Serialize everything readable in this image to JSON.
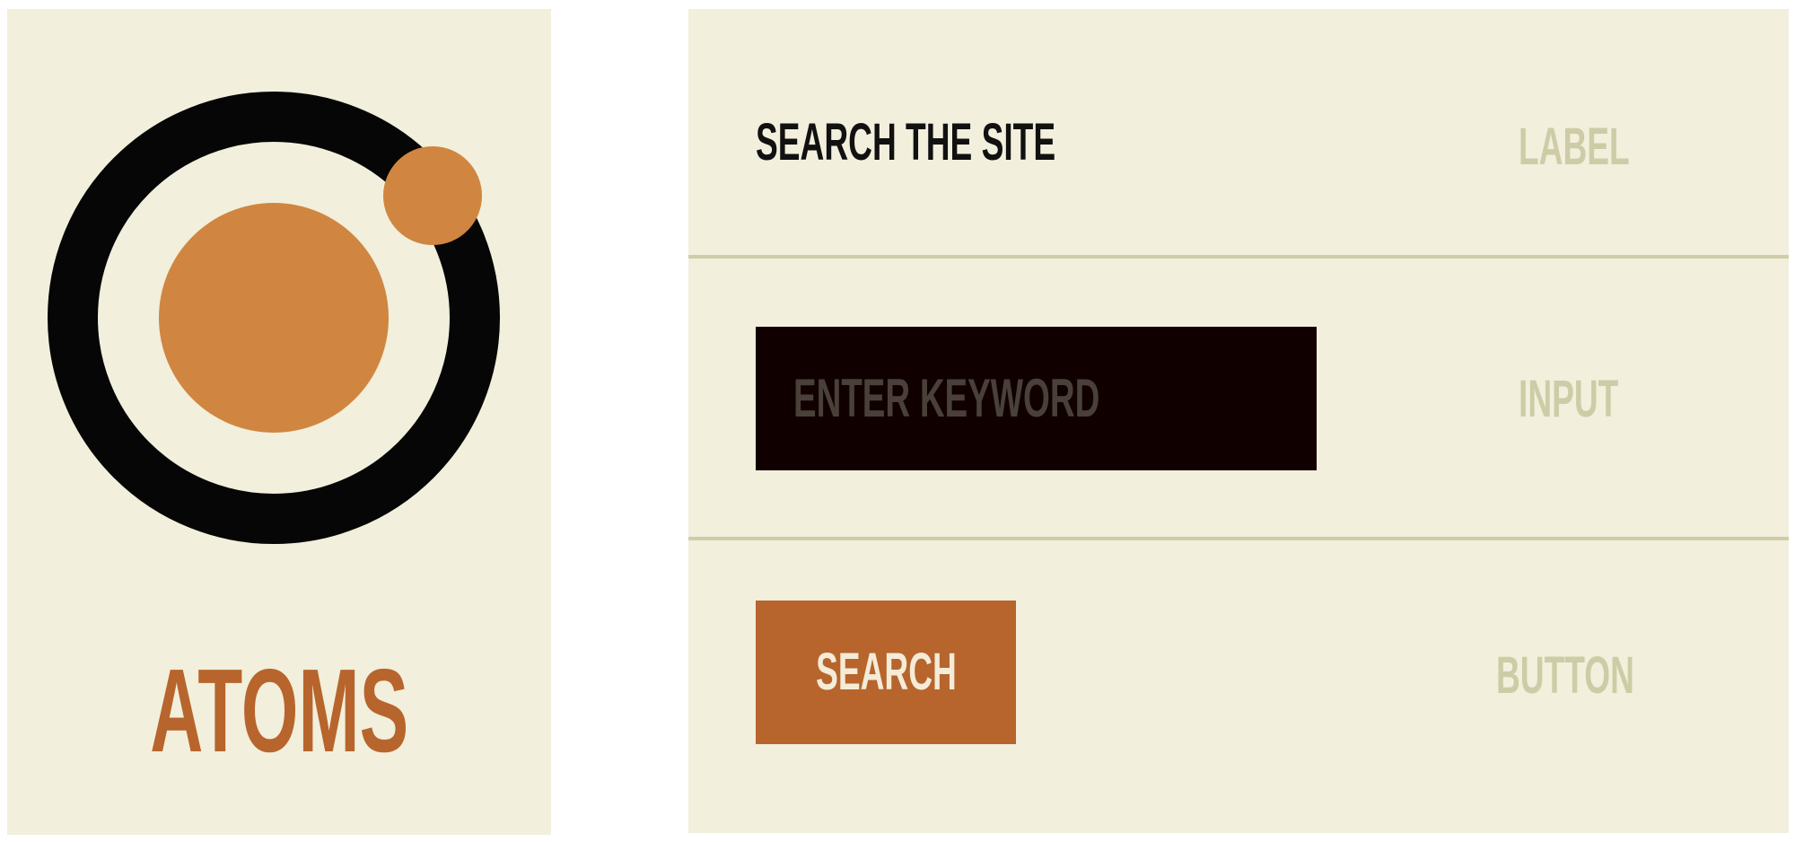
{
  "atoms_card": {
    "title": "ATOMS",
    "logo_icon": "atom-icon",
    "colors": {
      "ring": "#050605",
      "nucleus": "#d08640",
      "electron": "#d08640",
      "title": "#b7652c",
      "background": "#f2efdc"
    }
  },
  "components": {
    "label_row": {
      "text": "SEARCH THE SITE",
      "type_tag": "LABEL"
    },
    "input_row": {
      "placeholder": "ENTER KEYWORD",
      "type_tag": "INPUT"
    },
    "button_row": {
      "button_label": "SEARCH",
      "type_tag": "BUTTON"
    },
    "colors": {
      "background": "#f2efdc",
      "divider": "#cfcda8",
      "tag_text": "#cdcca6",
      "input_bg": "#100000",
      "button_bg": "#b7652c"
    }
  }
}
